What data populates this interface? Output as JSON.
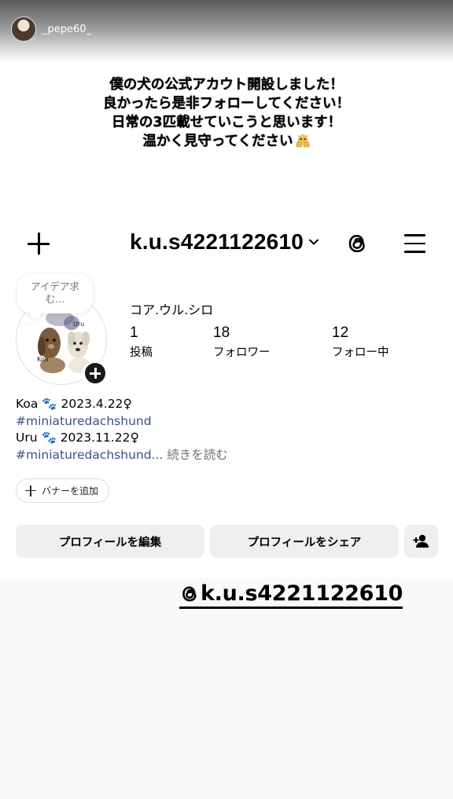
{
  "story": {
    "username": "_pepe60_"
  },
  "caption": {
    "lines": [
      "僕の犬の公式アカウト開設しました！",
      "良かったら是非フォローしてください！",
      "日常の3匹載せていこうと思います！",
      "温かく見守ってください"
    ],
    "emoji_icon": "pleading-hands-emoji"
  },
  "profile": {
    "username": "k.u.s4221122610",
    "note_text": "アイデア求む...",
    "display_name": "コア.ウル.シロ",
    "avatar_labels": [
      "Koa",
      "Uru"
    ],
    "stats": [
      {
        "value": "1",
        "label": "投稿"
      },
      {
        "value": "18",
        "label": "フォロワー"
      },
      {
        "value": "12",
        "label": "フォロー中"
      }
    ],
    "bio": {
      "line1": "Koa 🐾 2023.4.22♀",
      "line2": "#miniaturedachshund",
      "line3": "Uru 🐾 2023.11.22♀",
      "line4": "#miniaturedachshund...",
      "more": "続きを読む"
    },
    "banner_label": "バナーを追加",
    "edit_label": "プロフィールを編集",
    "share_label": "プロフィールをシェア"
  },
  "threads_sticker": {
    "text": "k.u.s4221122610"
  },
  "colors": {
    "hashtag": "#3b4f8e",
    "button_bg": "#efeff1",
    "muted_text": "#737373"
  }
}
